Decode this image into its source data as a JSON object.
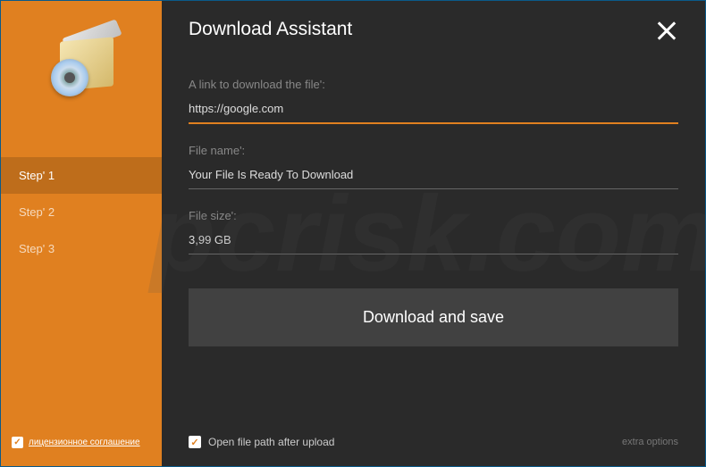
{
  "title": "Download Assistant",
  "sidebar": {
    "steps": [
      {
        "label": "Step' 1",
        "active": true
      },
      {
        "label": "Step' 2",
        "active": false
      },
      {
        "label": "Step' 3",
        "active": false
      }
    ],
    "license_agreement": "лицензионное соглашение",
    "license_checked": true
  },
  "form": {
    "url_label": "A link to download the file':",
    "url_value": "https://google.com",
    "filename_label": "File name':",
    "filename_value": "Your File Is Ready To Download",
    "filesize_label": "File size':",
    "filesize_value": "3,99 GB"
  },
  "download_button": "Download and save",
  "footer": {
    "open_path_label": "Open file path after upload",
    "open_path_checked": true,
    "extra_options": "extra options"
  }
}
